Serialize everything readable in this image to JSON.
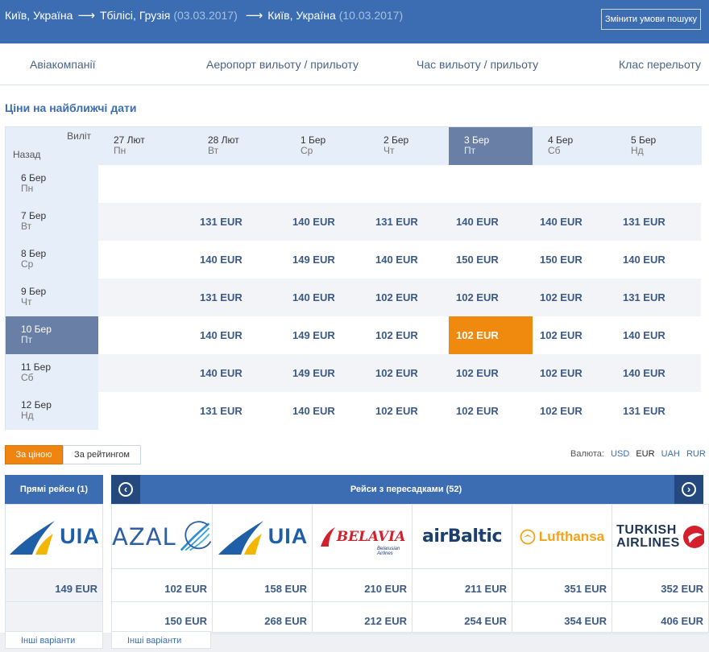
{
  "header": {
    "route": [
      {
        "city": "Київ, Україна",
        "date": ""
      },
      {
        "city": "Тбілісі, Грузія",
        "date": "(03.03.2017)"
      },
      {
        "city": "Київ, Україна",
        "date": "(10.03.2017)"
      }
    ],
    "change_button": "Змінити умови пошуку"
  },
  "filters": [
    {
      "label": "Авіакомпанії"
    },
    {
      "label": "Аеропорт вильоту / прильоту"
    },
    {
      "label": "Час вильоту / прильоту"
    },
    {
      "label": "Клас перельоту"
    }
  ],
  "section_title": "Ціни на найближчі дати",
  "matrix": {
    "corner_out": "Виліт",
    "corner_back": "Назад",
    "columns": [
      {
        "date": "27 Лют",
        "weekday": "Пн"
      },
      {
        "date": "28 Лют",
        "weekday": "Вт"
      },
      {
        "date": "1 Бер",
        "weekday": "Ср"
      },
      {
        "date": "2 Бер",
        "weekday": "Чт"
      },
      {
        "date": "3 Бер",
        "weekday": "Пт"
      },
      {
        "date": "4 Бер",
        "weekday": "Сб"
      },
      {
        "date": "5 Бер",
        "weekday": "Нд"
      }
    ],
    "selected_column": 4,
    "rows": [
      {
        "date": "6 Бер",
        "weekday": "Пн",
        "prices": [
          "",
          "",
          "",
          "",
          "",
          "",
          ""
        ]
      },
      {
        "date": "7 Бер",
        "weekday": "Вт",
        "prices": [
          "",
          "131 EUR",
          "140 EUR",
          "131 EUR",
          "140 EUR",
          "140 EUR",
          "131 EUR"
        ]
      },
      {
        "date": "8 Бер",
        "weekday": "Ср",
        "prices": [
          "",
          "140 EUR",
          "149 EUR",
          "140 EUR",
          "150 EUR",
          "150 EUR",
          "140 EUR"
        ]
      },
      {
        "date": "9 Бер",
        "weekday": "Чт",
        "prices": [
          "",
          "131 EUR",
          "140 EUR",
          "102 EUR",
          "102 EUR",
          "102 EUR",
          "131 EUR"
        ]
      },
      {
        "date": "10 Бер",
        "weekday": "Пт",
        "prices": [
          "",
          "140 EUR",
          "149 EUR",
          "102 EUR",
          "102 EUR",
          "102 EUR",
          "140 EUR"
        ]
      },
      {
        "date": "11 Бер",
        "weekday": "Сб",
        "prices": [
          "",
          "140 EUR",
          "149 EUR",
          "102 EUR",
          "102 EUR",
          "102 EUR",
          "140 EUR"
        ]
      },
      {
        "date": "12 Бер",
        "weekday": "Нд",
        "prices": [
          "",
          "131 EUR",
          "140 EUR",
          "102 EUR",
          "102 EUR",
          "102 EUR",
          "131 EUR"
        ]
      }
    ],
    "selected_row": 4
  },
  "sort": {
    "by_price": "За ціною",
    "by_rating": "За рейтингом"
  },
  "currency": {
    "label": "Валюта:",
    "options": [
      "USD",
      "EUR",
      "UAH",
      "RUR"
    ],
    "active": "EUR"
  },
  "results": {
    "direct_title": "Прямі рейси (1)",
    "transfer_title": "Рейси з пересадками (52)",
    "other_options": "Інші варіанти",
    "direct": [
      {
        "airline": "UIA",
        "logo_icon": "uia-logo-icon",
        "prices": [
          "149 EUR"
        ]
      }
    ],
    "transfer": [
      {
        "airline": "AZAL",
        "logo_icon": "azal-logo-icon",
        "prices": [
          "102 EUR",
          "150 EUR"
        ]
      },
      {
        "airline": "UIA",
        "logo_icon": "uia-logo-icon",
        "prices": [
          "158 EUR",
          "268 EUR"
        ]
      },
      {
        "airline": "BELAVIA",
        "sub": "Belarusian Airlines",
        "logo_icon": "belavia-logo-icon",
        "prices": [
          "210 EUR",
          "212 EUR"
        ]
      },
      {
        "airline": "airBaltic",
        "logo_icon": "airbaltic-logo-icon",
        "prices": [
          "211 EUR",
          "254 EUR"
        ]
      },
      {
        "airline": "Lufthansa",
        "logo_icon": "lufthansa-logo-icon",
        "prices": [
          "351 EUR",
          "354 EUR"
        ]
      },
      {
        "airline_line1": "TURKISH",
        "airline_line2": "AIRLINES",
        "logo_icon": "turkish-logo-icon",
        "prices": [
          "352 EUR",
          "406 EUR"
        ]
      }
    ]
  },
  "colors": {
    "header_blue": "#3c6db2",
    "selected_cell": "#f08a0e",
    "selected_header": "#6a7fa6"
  }
}
